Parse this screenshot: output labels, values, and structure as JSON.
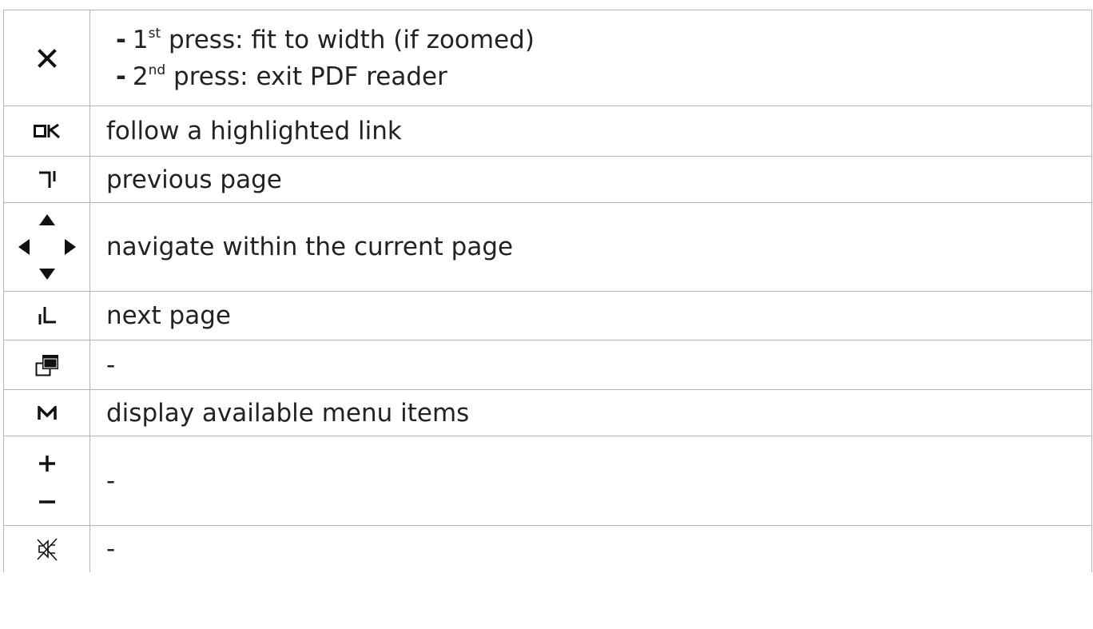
{
  "rows": [
    {
      "key": {
        "icon": "close-x-icon"
      },
      "lines": [
        {
          "bullet": "-",
          "num": "1",
          "sup": "st",
          "text": " press: fit to width (if zoomed)"
        },
        {
          "bullet": "-",
          "num": "2",
          "sup": "nd",
          "text": " press: exit PDF reader"
        }
      ]
    },
    {
      "key": {
        "label": "OK",
        "icon": "ok-key-icon"
      },
      "text": "follow a highlighted link"
    },
    {
      "key": {
        "icon": "previous-page-key-icon"
      },
      "text": "previous page"
    },
    {
      "key": {
        "icon": "navigation-arrows-icon"
      },
      "text": "navigate within the current page"
    },
    {
      "key": {
        "icon": "next-page-key-icon"
      },
      "text": "next page"
    },
    {
      "key": {
        "icon": "windows-key-icon"
      },
      "text": "-"
    },
    {
      "key": {
        "label": "M",
        "icon": "menu-key-icon"
      },
      "text": "display available menu items"
    },
    {
      "key": {
        "icon": "volume-plus-minus-icon"
      },
      "text": "-"
    },
    {
      "key": {
        "icon": "mute-key-icon"
      },
      "text": "-"
    }
  ],
  "colors": {
    "grid": "#b5b5b5",
    "text": "#222222",
    "icon": "#111111"
  }
}
